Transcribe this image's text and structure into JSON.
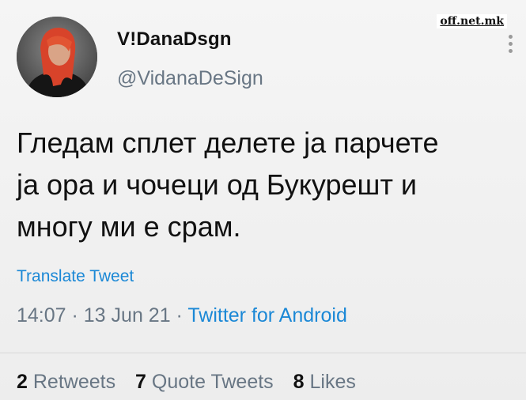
{
  "watermark": "off.net.mk",
  "user": {
    "display_name": "V!DanaDsgn",
    "handle": "@VidanaDeSign"
  },
  "tweet": {
    "lines": [
      "Гледам сплет делете ја парчете",
      "ја ора и чочеци од Букурешт и",
      "многу ми е срам."
    ],
    "translate_label": "Translate Tweet"
  },
  "meta": {
    "time": "14:07",
    "separator": " · ",
    "date": "13 Jun 21",
    "source": "Twitter for Android"
  },
  "stats": {
    "retweets_count": "2",
    "retweets_label": "Retweets",
    "quotes_count": "7",
    "quotes_label": "Quote Tweets",
    "likes_count": "8",
    "likes_label": "Likes"
  },
  "colors": {
    "link": "#1b88d6",
    "muted": "#687684"
  }
}
